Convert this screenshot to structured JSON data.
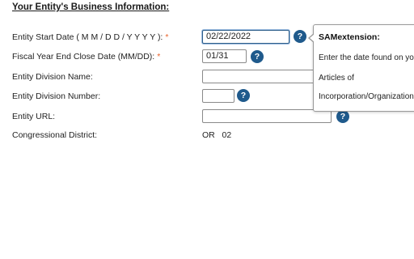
{
  "section": {
    "title": "Your Entity's Business Information:"
  },
  "fields": {
    "start_date": {
      "label": "Entity Start Date ( M M / D D / Y Y Y Y ):",
      "required_mark": "*",
      "value": "02/22/2022"
    },
    "fiscal_year": {
      "label": "Fiscal Year End Close Date (MM/DD):",
      "required_mark": "*",
      "value": "01/31"
    },
    "division_name": {
      "label": "Entity Division Name:",
      "value": ""
    },
    "division_number": {
      "label": "Entity Division Number:",
      "value": ""
    },
    "url": {
      "label": "Entity URL:",
      "value": ""
    },
    "congressional": {
      "label": "Congressional District:",
      "state": "OR",
      "district": "02"
    }
  },
  "help_icon": {
    "glyph": "?"
  },
  "tooltip": {
    "title": "SAMextension:",
    "lines": [
      "Enter the date found on you",
      "Articles of",
      "Incorporation/Organization."
    ]
  },
  "colors": {
    "help_icon": "#1f5a8c",
    "required": "#e8632b",
    "focus_border": "#2f5f8a"
  }
}
